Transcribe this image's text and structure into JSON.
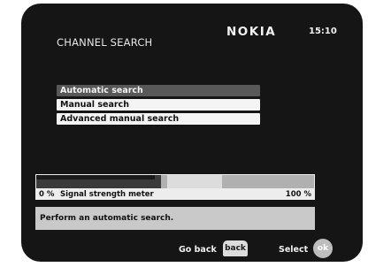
{
  "header": {
    "title": "CHANNEL SEARCH",
    "brand": "NOKIA",
    "clock": "15:10"
  },
  "menu": {
    "items": [
      {
        "label": "Automatic search",
        "selected": true
      },
      {
        "label": "Manual search",
        "selected": false
      },
      {
        "label": "Advanced manual search",
        "selected": false
      }
    ]
  },
  "signal_meter": {
    "label": "Signal strength meter",
    "min_label": "0 %",
    "max_label": "100 %",
    "level_fraction": 0.45
  },
  "info": {
    "text": "Perform an automatic search."
  },
  "footer": {
    "back_label": "Go back",
    "back_key": "back",
    "select_label": "Select",
    "select_key": "ok"
  },
  "colors": {
    "screen_background": "#151515",
    "selected_item": "#585858",
    "menu_item": "#f4f4f4",
    "info_box": "#c9c9c9"
  }
}
